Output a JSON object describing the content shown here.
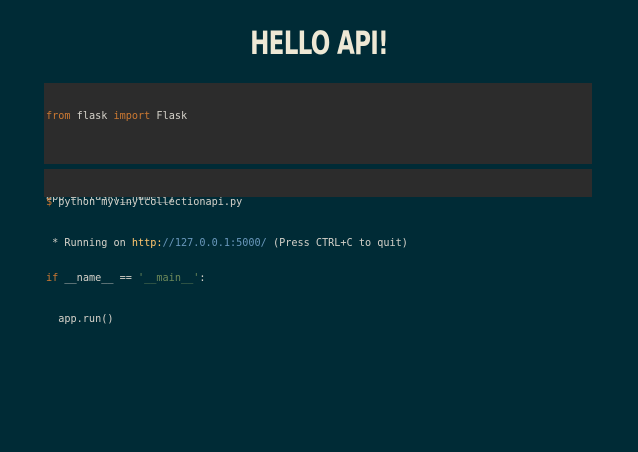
{
  "slide": {
    "title": "HELLO API!"
  },
  "source_code": {
    "line1": {
      "kw1": "from",
      "mod": " flask ",
      "kw2": "import",
      "name": " Flask"
    },
    "line2": "",
    "line3": "app = Flask(__name__)",
    "line4": "",
    "line5": {
      "kw": "if",
      "cond": " __name__ == ",
      "str": "'__main__'",
      "end": ":"
    },
    "line6": "  app.run()"
  },
  "shell_output": {
    "prompt": "$",
    "command": " python myvinylcollectionapi.py",
    "line2_prefix": " * Running on ",
    "url_scheme": "http:",
    "url_rest": "//127.0.0.1:5000/",
    "line2_suffix": " (Press CTRL+C to quit)"
  },
  "colors": {
    "background": "#002b36",
    "code_background": "#2c2c2c",
    "title": "#eee8d5",
    "keyword": "#cb7832",
    "string": "#6a8759",
    "number": "#6897bb"
  }
}
